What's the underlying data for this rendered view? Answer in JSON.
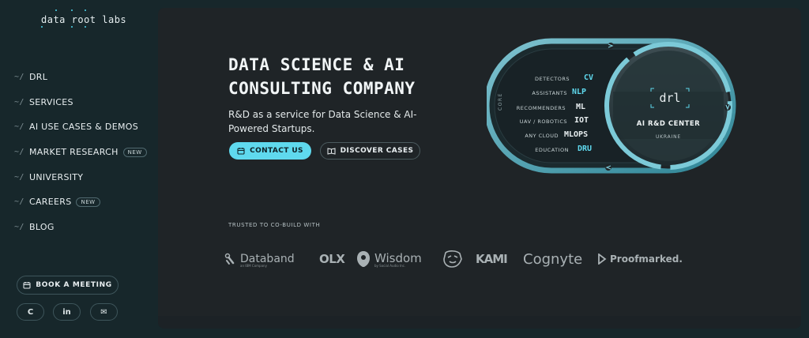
{
  "brand": {
    "name": "data root labs"
  },
  "nav": {
    "prefix": "~/",
    "items": [
      {
        "label": "DRL",
        "badge": ""
      },
      {
        "label": "SERVICES",
        "badge": ""
      },
      {
        "label": "AI USE CASES & DEMOS",
        "badge": ""
      },
      {
        "label": "MARKET RESEARCH",
        "badge": "NEW"
      },
      {
        "label": "UNIVERSITY",
        "badge": ""
      },
      {
        "label": "CAREERS",
        "badge": "NEW"
      },
      {
        "label": "BLOG",
        "badge": ""
      }
    ]
  },
  "sidebar": {
    "book_label": "BOOK A MEETING",
    "social": [
      {
        "icon": "clutch-icon",
        "glyph": "C"
      },
      {
        "icon": "linkedin-icon",
        "glyph": "in"
      },
      {
        "icon": "mail-icon",
        "glyph": "✉"
      }
    ]
  },
  "hero": {
    "title_line1": "DATA SCIENCE & AI",
    "title_line2": "CONSULTING COMPANY",
    "subtitle": "R&D as a service for Data Science & AI-Powered Startups.",
    "contact_label": "CONTACT US",
    "discover_label": "DISCOVER CASES"
  },
  "diagram": {
    "core_label": "CORE",
    "center_logo": "drl",
    "center_title": "AI R&D CENTER",
    "center_sub": "UKRAINE",
    "rows": [
      {
        "label": "DETECTORS",
        "code": "CV",
        "accent": true
      },
      {
        "label": "ASSISTANTS",
        "code": "NLP",
        "accent": true
      },
      {
        "label": "RECOMMENDERS",
        "code": "ML",
        "accent": false
      },
      {
        "label": "UAV / ROBOTICS",
        "code": "IOT",
        "accent": false
      },
      {
        "label": "ANY CLOUD",
        "code": "MLOPS",
        "accent": false
      },
      {
        "label": "EDUCATION",
        "code": "DRU",
        "accent": true
      }
    ]
  },
  "trusted": {
    "label": "TRUSTED TO CO-BUILD WITH",
    "logos": [
      {
        "name": "Databand",
        "sub": "an IBM Company"
      },
      {
        "name": "OLX",
        "sub": ""
      },
      {
        "name": "Wisdom",
        "sub": "by Social Audio Inc."
      },
      {
        "name": "Avatar mark",
        "sub": ""
      },
      {
        "name": "KAMI",
        "sub": ""
      },
      {
        "name": "Cognyte",
        "sub": ""
      },
      {
        "name": "Proofmarked.",
        "sub": ""
      }
    ]
  },
  "colors": {
    "accent": "#5fd9ee",
    "panel": "#1f2427",
    "sidebar": "#17272b"
  }
}
